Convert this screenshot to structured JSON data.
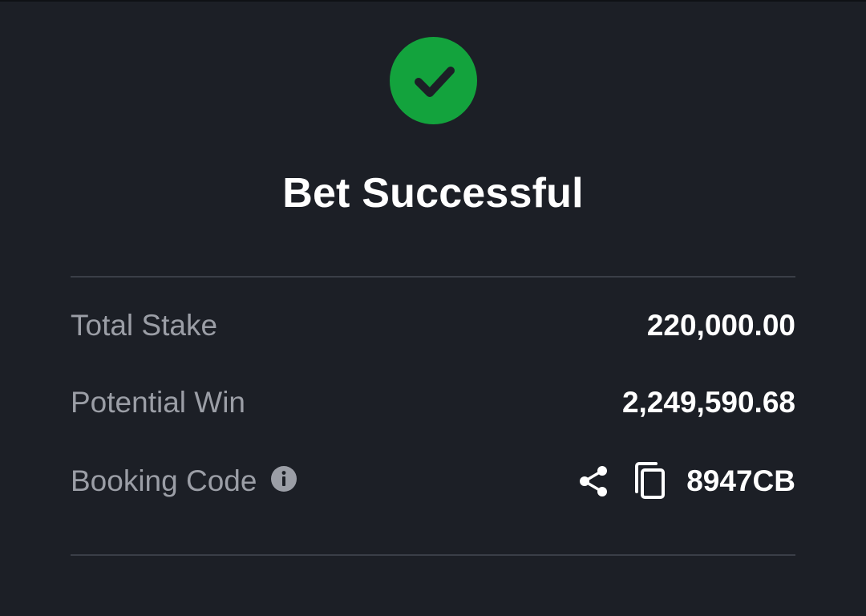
{
  "status": {
    "icon": "check-circle-icon",
    "title": "Bet Successful",
    "color": "#13a33d"
  },
  "details": {
    "total_stake": {
      "label": "Total Stake",
      "value": "220,000.00"
    },
    "potential_win": {
      "label": "Potential Win",
      "value": "2,249,590.68"
    },
    "booking_code": {
      "label": "Booking Code",
      "info_icon": "info-icon",
      "share_icon": "share-icon",
      "copy_icon": "copy-icon",
      "value": "8947CB"
    }
  },
  "colors": {
    "background": "#1c1f26",
    "divider": "#3a3e47",
    "label": "#9b9ea6",
    "value": "#ffffff"
  }
}
